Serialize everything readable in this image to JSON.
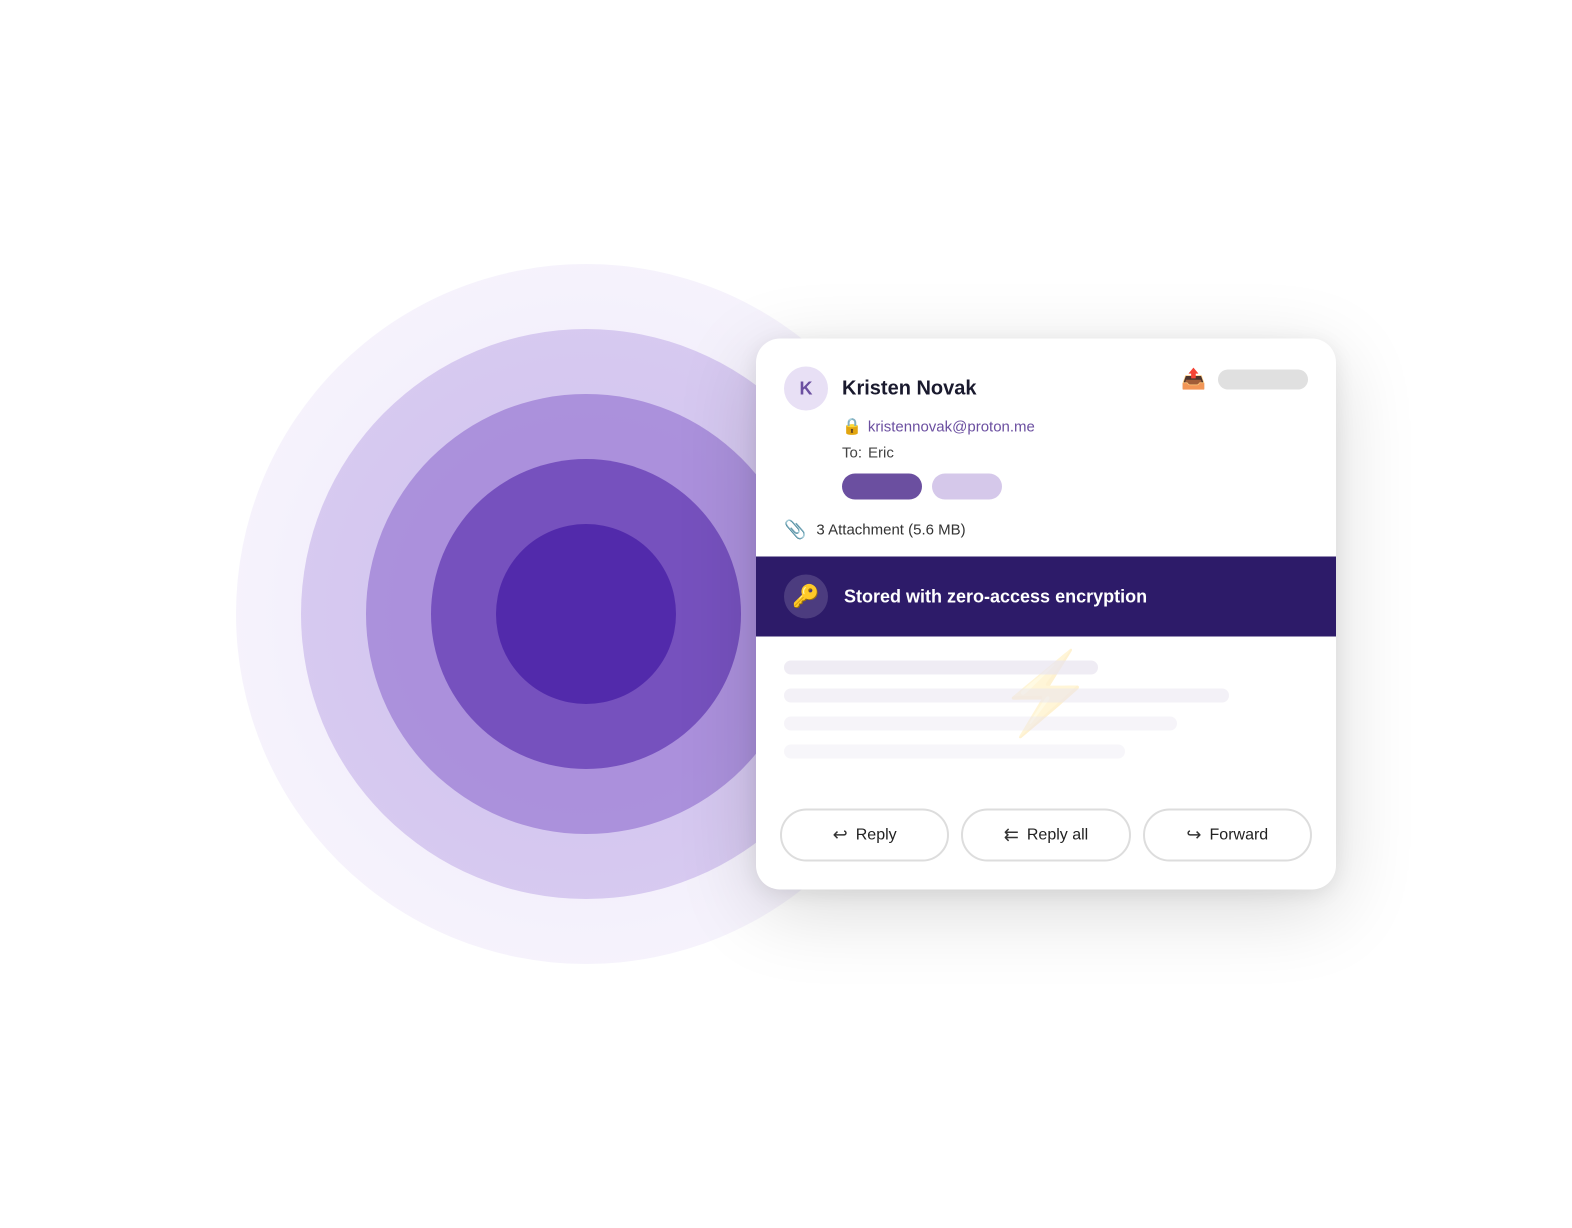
{
  "scene": {
    "background": "#ffffff"
  },
  "circles": {
    "colors": [
      "#e8e0f5",
      "#c4a8e8",
      "#9b6fd4",
      "#7040c0",
      "#5a28b0"
    ]
  },
  "email_card": {
    "avatar_letter": "K",
    "sender_name": "Kristen Novak",
    "email_address": "kristennovak@proton.me",
    "to_label": "To:",
    "to_recipient": "Eric",
    "attachment_text": "3 Attachment (5.6 MB)",
    "encryption_label": "Stored with zero-access encryption",
    "reply_label": "Reply",
    "reply_all_label": "Reply all",
    "forward_label": "Forward"
  }
}
